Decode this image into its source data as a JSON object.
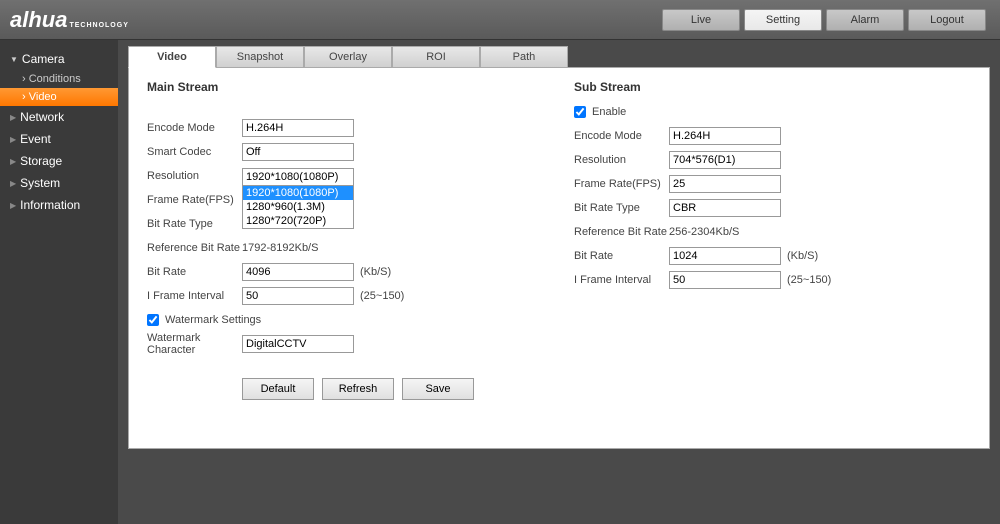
{
  "brand": {
    "name": "alhua",
    "sub": "TECHNOLOGY"
  },
  "topnav": {
    "live": "Live",
    "setting": "Setting",
    "alarm": "Alarm",
    "logout": "Logout"
  },
  "sidebar": {
    "camera": "Camera",
    "conditions": "Conditions",
    "video": "Video",
    "network": "Network",
    "event": "Event",
    "storage": "Storage",
    "system": "System",
    "information": "Information"
  },
  "tabs": {
    "video": "Video",
    "snapshot": "Snapshot",
    "overlay": "Overlay",
    "roi": "ROI",
    "path": "Path"
  },
  "main": {
    "title": "Main Stream",
    "encode_mode_label": "Encode Mode",
    "encode_mode": "H.264H",
    "smart_codec_label": "Smart Codec",
    "smart_codec": "Off",
    "resolution_label": "Resolution",
    "resolution": "1920*1080(1080P)",
    "resolution_options": [
      "1920*1080(1080P)",
      "1280*960(1.3M)",
      "1280*720(720P)"
    ],
    "fps_label": "Frame Rate(FPS)",
    "fps": "",
    "bitrate_type_label": "Bit Rate Type",
    "bitrate_type": "",
    "ref_bitrate_label": "Reference Bit Rate",
    "ref_bitrate": "1792-8192Kb/S",
    "bitrate_label": "Bit Rate",
    "bitrate": "4096",
    "bitrate_unit": "(Kb/S)",
    "iframe_label": "I Frame Interval",
    "iframe": "50",
    "iframe_hint": "(25~150)",
    "watermark_label": "Watermark Settings",
    "watermark_char_label": "Watermark Character",
    "watermark_char": "DigitalCCTV"
  },
  "sub": {
    "title": "Sub Stream",
    "enable_label": "Enable",
    "encode_mode_label": "Encode Mode",
    "encode_mode": "H.264H",
    "resolution_label": "Resolution",
    "resolution": "704*576(D1)",
    "fps_label": "Frame Rate(FPS)",
    "fps": "25",
    "bitrate_type_label": "Bit Rate Type",
    "bitrate_type": "CBR",
    "ref_bitrate_label": "Reference Bit Rate",
    "ref_bitrate": "256-2304Kb/S",
    "bitrate_label": "Bit Rate",
    "bitrate": "1024",
    "bitrate_unit": "(Kb/S)",
    "iframe_label": "I Frame Interval",
    "iframe": "50",
    "iframe_hint": "(25~150)"
  },
  "buttons": {
    "default": "Default",
    "refresh": "Refresh",
    "save": "Save"
  }
}
